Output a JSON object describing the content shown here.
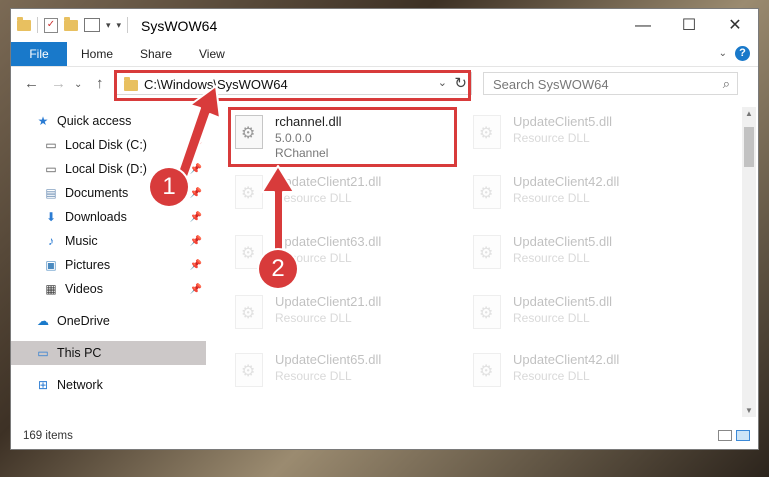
{
  "window": {
    "title": "SysWOW64",
    "controls": {
      "minimize": "—",
      "maximize": "☐",
      "close": "✕"
    }
  },
  "ribbon": {
    "file_tab": "File",
    "tabs": [
      "Home",
      "Share",
      "View"
    ],
    "accent": "#1979ca"
  },
  "nav": {
    "address": "C:\\Windows\\SysWOW64",
    "search_placeholder": "Search SysWOW64"
  },
  "sidebar": {
    "items": [
      {
        "label": "Quick access",
        "icon": "star-icon"
      },
      {
        "label": "Local Disk (C:)",
        "icon": "drive-icon"
      },
      {
        "label": "Local Disk (D:)",
        "icon": "drive-icon"
      },
      {
        "label": "Documents",
        "icon": "documents-icon"
      },
      {
        "label": "Downloads",
        "icon": "download-icon"
      },
      {
        "label": "Music",
        "icon": "music-icon"
      },
      {
        "label": "Pictures",
        "icon": "pictures-icon"
      },
      {
        "label": "Videos",
        "icon": "videos-icon"
      },
      {
        "label": "OneDrive",
        "icon": "cloud-icon"
      },
      {
        "label": "This PC",
        "icon": "computer-icon"
      },
      {
        "label": "Network",
        "icon": "network-icon"
      }
    ]
  },
  "files": {
    "main": {
      "name": "rchannel.dll",
      "version": "5.0.0.0",
      "description": "RChannel"
    },
    "faded": [
      {
        "name": "UpdateClient5.dll",
        "type": "Resource DLL"
      },
      {
        "name": "UpdateClient21.dll",
        "type": "Resource DLL"
      },
      {
        "name": "UpdateClient42.dll",
        "type": "Resource DLL"
      },
      {
        "name": "UpdateClient63.dll",
        "type": "Resource DLL"
      },
      {
        "name": "UpdateClient5.dll",
        "type": "Resource DLL"
      },
      {
        "name": "UpdateClient21.dll",
        "type": "Resource DLL"
      },
      {
        "name": "UpdateClient5.dll",
        "type": "Resource DLL"
      },
      {
        "name": "UpdateClient65.dll",
        "type": "Resource DLL"
      },
      {
        "name": "UpdateClient42.dll",
        "type": "Resource DLL"
      }
    ]
  },
  "status": {
    "items_count": "169 items"
  },
  "annotations": {
    "step1": "1",
    "step2": "2",
    "color": "#d83b3b"
  }
}
